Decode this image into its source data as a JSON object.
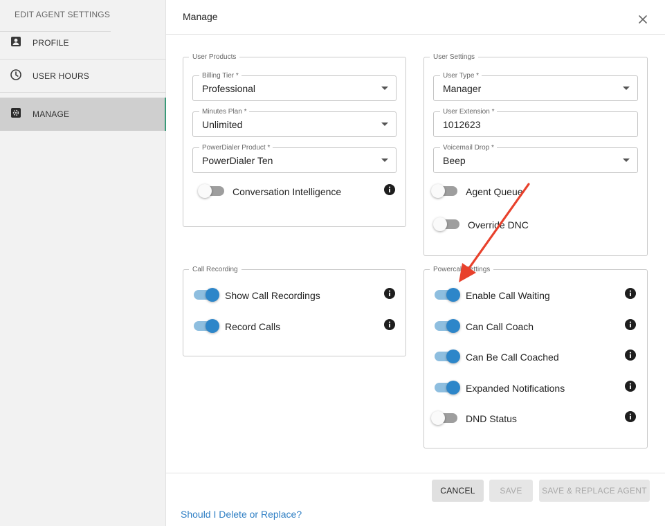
{
  "sidebar": {
    "heading": "EDIT AGENT SETTINGS",
    "items": [
      {
        "label": "PROFILE",
        "icon": "profile-icon"
      },
      {
        "label": "USER HOURS",
        "icon": "clock-icon"
      },
      {
        "label": "MANAGE",
        "icon": "gear-icon",
        "active": true
      }
    ]
  },
  "dialog": {
    "title": "Manage",
    "close_icon": "close-icon"
  },
  "user_products": {
    "legend": "User Products",
    "billing_tier": {
      "label": "Billing Tier *",
      "value": "Professional"
    },
    "minutes_plan": {
      "label": "Minutes Plan *",
      "value": "Unlimited"
    },
    "powerdialer_product": {
      "label": "PowerDialer Product *",
      "value": "PowerDialer Ten"
    },
    "conversation_intelligence": {
      "label": "Conversation Intelligence",
      "on": false
    }
  },
  "user_settings": {
    "legend": "User Settings",
    "user_type": {
      "label": "User Type *",
      "value": "Manager"
    },
    "user_extension": {
      "label": "User Extension *",
      "value": "1012623"
    },
    "voicemail_drop": {
      "label": "Voicemail Drop *",
      "value": "Beep"
    },
    "agent_queue": {
      "label": "Agent Queue",
      "on": false
    },
    "override_dnc": {
      "label": "Override DNC",
      "on": false
    }
  },
  "call_recording": {
    "legend": "Call Recording",
    "show_call_recordings": {
      "label": "Show Call Recordings",
      "on": true
    },
    "record_calls": {
      "label": "Record Calls",
      "on": true
    }
  },
  "powercall_settings": {
    "legend": "Powercall Settings",
    "enable_call_waiting": {
      "label": "Enable Call Waiting",
      "on": true
    },
    "can_call_coach": {
      "label": "Can Call Coach",
      "on": true
    },
    "can_be_call_coached": {
      "label": "Can Be Call Coached",
      "on": true
    },
    "expanded_notifications": {
      "label": "Expanded Notifications",
      "on": true
    },
    "dnd_status": {
      "label": "DND Status",
      "on": false
    }
  },
  "footer": {
    "cancel_label": "CANCEL",
    "save_label": "SAVE",
    "save_replace_label": "SAVE & REPLACE AGENT",
    "help_link": "Should I Delete or Replace?"
  },
  "colors": {
    "toggle_on": "#2d86c9",
    "toggle_on_track": "#8ebedf",
    "active_nav_border": "#3a9a78",
    "link": "#2f7fc4",
    "annotation_arrow": "#e8412c"
  }
}
